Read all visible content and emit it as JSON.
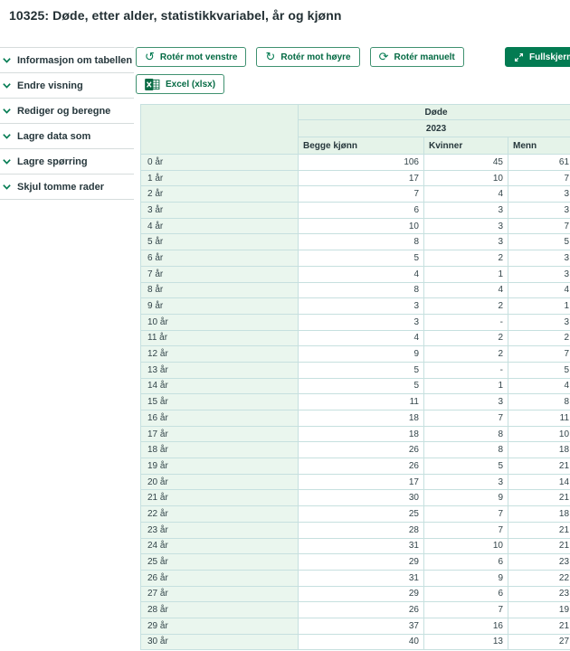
{
  "page": {
    "title": "10325: Døde, etter alder, statistikkvariabel, år og kjønn"
  },
  "sidebar": {
    "items": [
      {
        "label": "Informasjon om tabellen"
      },
      {
        "label": "Endre visning"
      },
      {
        "label": "Rediger og beregne"
      },
      {
        "label": "Lagre data som"
      },
      {
        "label": "Lagre spørring"
      },
      {
        "label": "Skjul tomme rader"
      }
    ]
  },
  "toolbar": {
    "rotate_left_label": "Rotér mot venstre",
    "rotate_right_label": "Rotér mot høyre",
    "rotate_manual_label": "Rotér manuelt",
    "fullscreen_label": "Fullskjerm",
    "excel_label": "Excel (xlsx)",
    "icons": {
      "rotate_left": "↺",
      "rotate_right": "↻",
      "rotate_manual": "⟳"
    }
  },
  "table": {
    "variable_header": "Døde",
    "year_header": "2023",
    "columns": [
      "Begge kjønn",
      "Kvinner",
      "Menn"
    ],
    "rows": [
      {
        "label": "0 år",
        "values": [
          "106",
          "45",
          "61"
        ]
      },
      {
        "label": "1 år",
        "values": [
          "17",
          "10",
          "7"
        ]
      },
      {
        "label": "2 år",
        "values": [
          "7",
          "4",
          "3"
        ]
      },
      {
        "label": "3 år",
        "values": [
          "6",
          "3",
          "3"
        ]
      },
      {
        "label": "4 år",
        "values": [
          "10",
          "3",
          "7"
        ]
      },
      {
        "label": "5 år",
        "values": [
          "8",
          "3",
          "5"
        ]
      },
      {
        "label": "6 år",
        "values": [
          "5",
          "2",
          "3"
        ]
      },
      {
        "label": "7 år",
        "values": [
          "4",
          "1",
          "3"
        ]
      },
      {
        "label": "8 år",
        "values": [
          "8",
          "4",
          "4"
        ]
      },
      {
        "label": "9 år",
        "values": [
          "3",
          "2",
          "1"
        ]
      },
      {
        "label": "10 år",
        "values": [
          "3",
          "-",
          "3"
        ]
      },
      {
        "label": "11 år",
        "values": [
          "4",
          "2",
          "2"
        ]
      },
      {
        "label": "12 år",
        "values": [
          "9",
          "2",
          "7"
        ]
      },
      {
        "label": "13 år",
        "values": [
          "5",
          "-",
          "5"
        ]
      },
      {
        "label": "14 år",
        "values": [
          "5",
          "1",
          "4"
        ]
      },
      {
        "label": "15 år",
        "values": [
          "11",
          "3",
          "8"
        ]
      },
      {
        "label": "16 år",
        "values": [
          "18",
          "7",
          "11"
        ]
      },
      {
        "label": "17 år",
        "values": [
          "18",
          "8",
          "10"
        ]
      },
      {
        "label": "18 år",
        "values": [
          "26",
          "8",
          "18"
        ]
      },
      {
        "label": "19 år",
        "values": [
          "26",
          "5",
          "21"
        ]
      },
      {
        "label": "20 år",
        "values": [
          "17",
          "3",
          "14"
        ]
      },
      {
        "label": "21 år",
        "values": [
          "30",
          "9",
          "21"
        ]
      },
      {
        "label": "22 år",
        "values": [
          "25",
          "7",
          "18"
        ]
      },
      {
        "label": "23 år",
        "values": [
          "28",
          "7",
          "21"
        ]
      },
      {
        "label": "24 år",
        "values": [
          "31",
          "10",
          "21"
        ]
      },
      {
        "label": "25 år",
        "values": [
          "29",
          "6",
          "23"
        ]
      },
      {
        "label": "26 år",
        "values": [
          "31",
          "9",
          "22"
        ]
      },
      {
        "label": "27 år",
        "values": [
          "29",
          "6",
          "23"
        ]
      },
      {
        "label": "28 år",
        "values": [
          "26",
          "7",
          "19"
        ]
      },
      {
        "label": "29 år",
        "values": [
          "37",
          "16",
          "21"
        ]
      },
      {
        "label": "30 år",
        "values": [
          "40",
          "13",
          "27"
        ]
      }
    ]
  },
  "colors": {
    "primary_green": "#037b52",
    "button_border_green": "#3f9170",
    "table_border": "#c6e0df",
    "header_bg": "#e5f3e9",
    "row_label_bg": "#eaf6ee",
    "dark_text": "#26373c"
  }
}
